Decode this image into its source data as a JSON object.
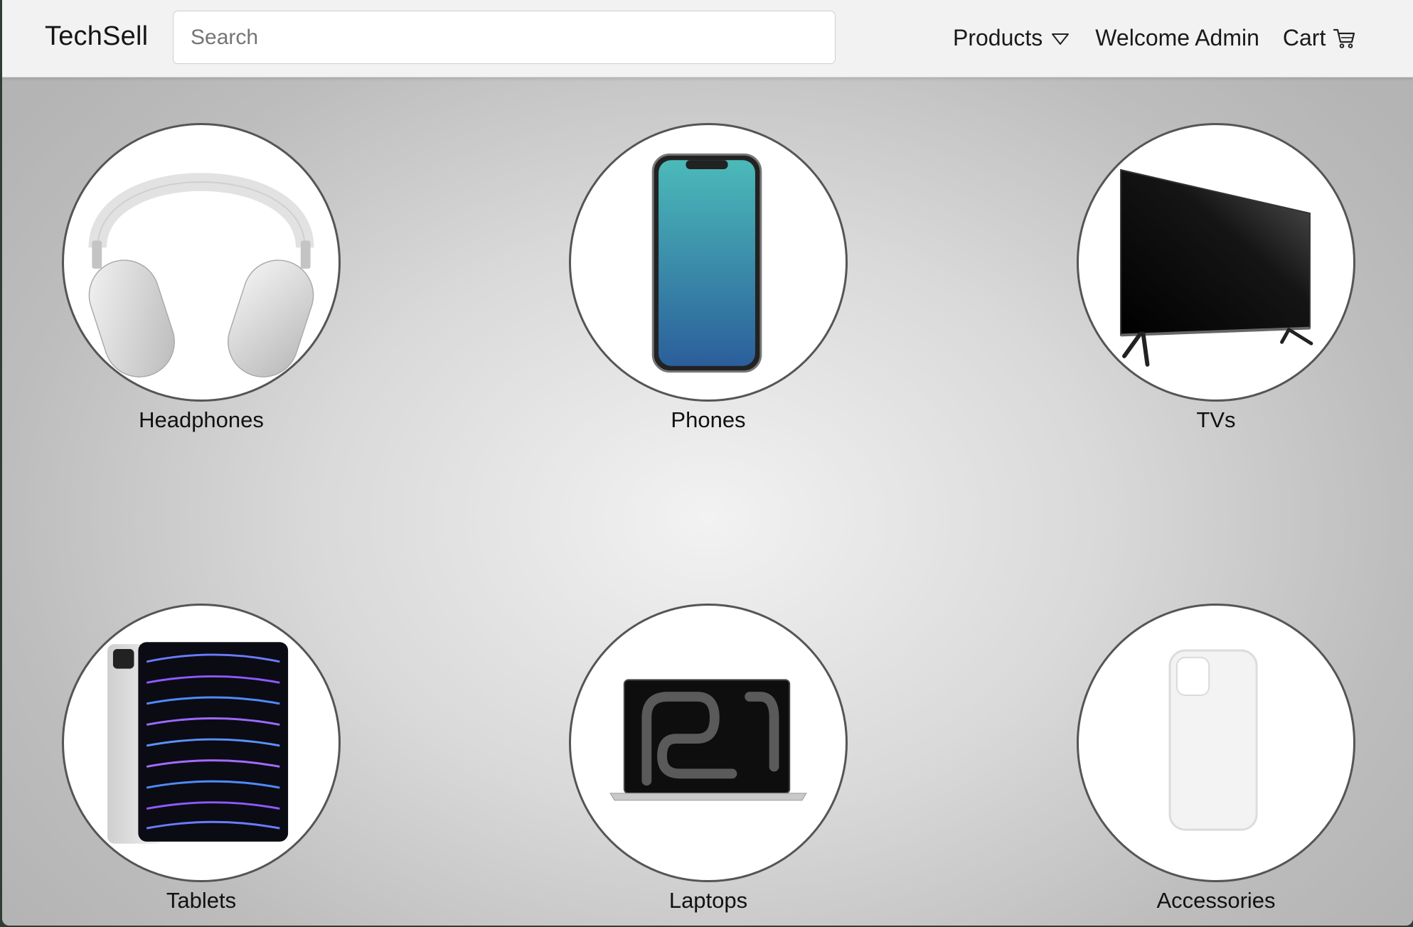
{
  "navbar": {
    "brand": "TechSell",
    "search_placeholder": "Search",
    "products_label": "Products",
    "welcome_label": "Welcome Admin",
    "cart_label": "Cart"
  },
  "categories": [
    {
      "label": "Headphones",
      "icon": "headphones-image"
    },
    {
      "label": "Phones",
      "icon": "phone-image"
    },
    {
      "label": "TVs",
      "icon": "tv-image"
    },
    {
      "label": "Tablets",
      "icon": "tablet-image"
    },
    {
      "label": "Laptops",
      "icon": "laptop-image"
    },
    {
      "label": "Accessories",
      "icon": "phone-case-image"
    }
  ]
}
